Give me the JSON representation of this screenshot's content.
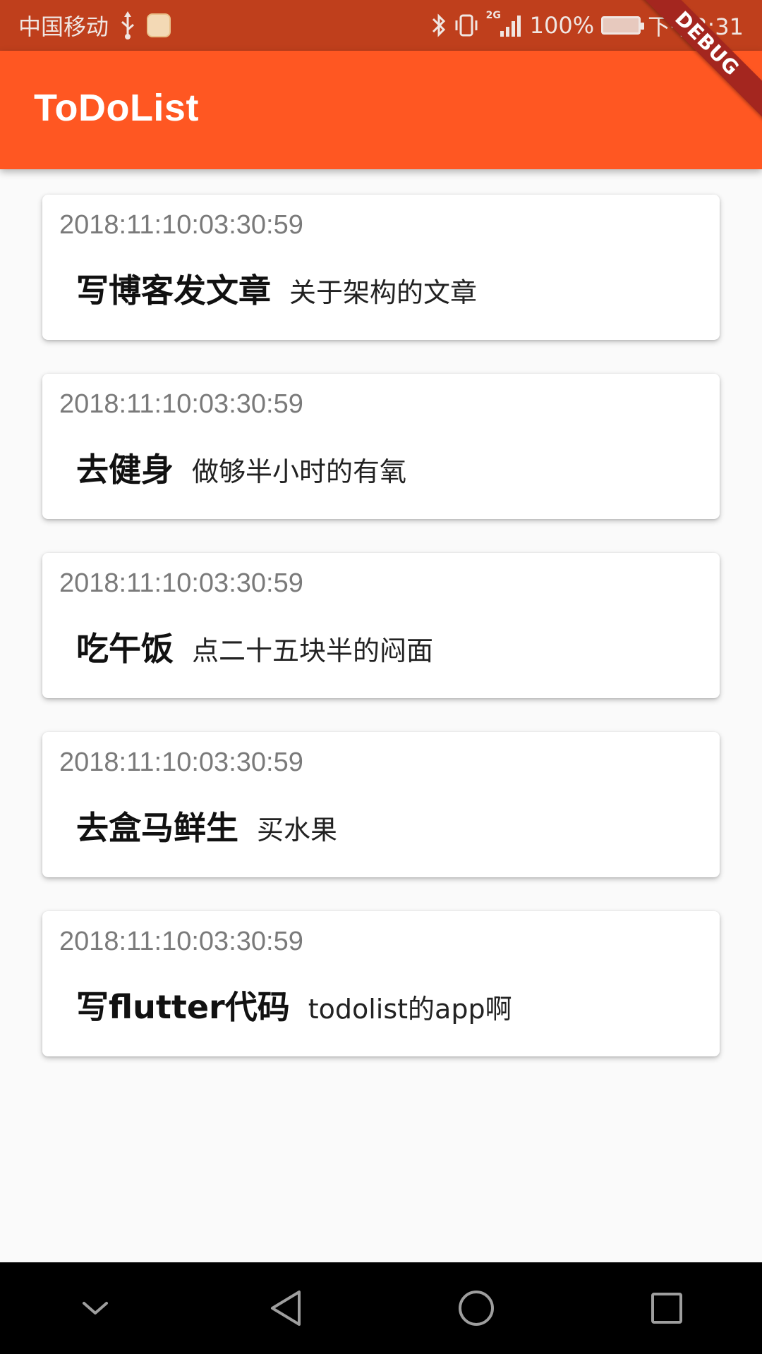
{
  "status_bar": {
    "carrier": "中国移动",
    "network": "2G",
    "battery": "100%",
    "time": "下午3:31",
    "colors": {
      "background": "#bf3f1c",
      "text": "#f0e6e2"
    }
  },
  "app_bar": {
    "title": "ToDoList",
    "color": "#ff5722"
  },
  "debug_banner": "DEBUG",
  "todos": [
    {
      "time": "2018:11:10:03:30:59",
      "title": "写博客发文章",
      "desc": "关于架构的文章"
    },
    {
      "time": "2018:11:10:03:30:59",
      "title": "去健身",
      "desc": "做够半小时的有氧"
    },
    {
      "time": "2018:11:10:03:30:59",
      "title": "吃午饭",
      "desc": "点二十五块半的闷面"
    },
    {
      "time": "2018:11:10:03:30:59",
      "title": "去盒马鲜生",
      "desc": "买水果"
    },
    {
      "time": "2018:11:10:03:30:59",
      "title": "写flutter代码",
      "desc": "todolist的app啊"
    }
  ],
  "nav_bar": {
    "icons": [
      "chevron-down-icon",
      "back-triangle-icon",
      "home-circle-icon",
      "recents-square-icon"
    ]
  }
}
